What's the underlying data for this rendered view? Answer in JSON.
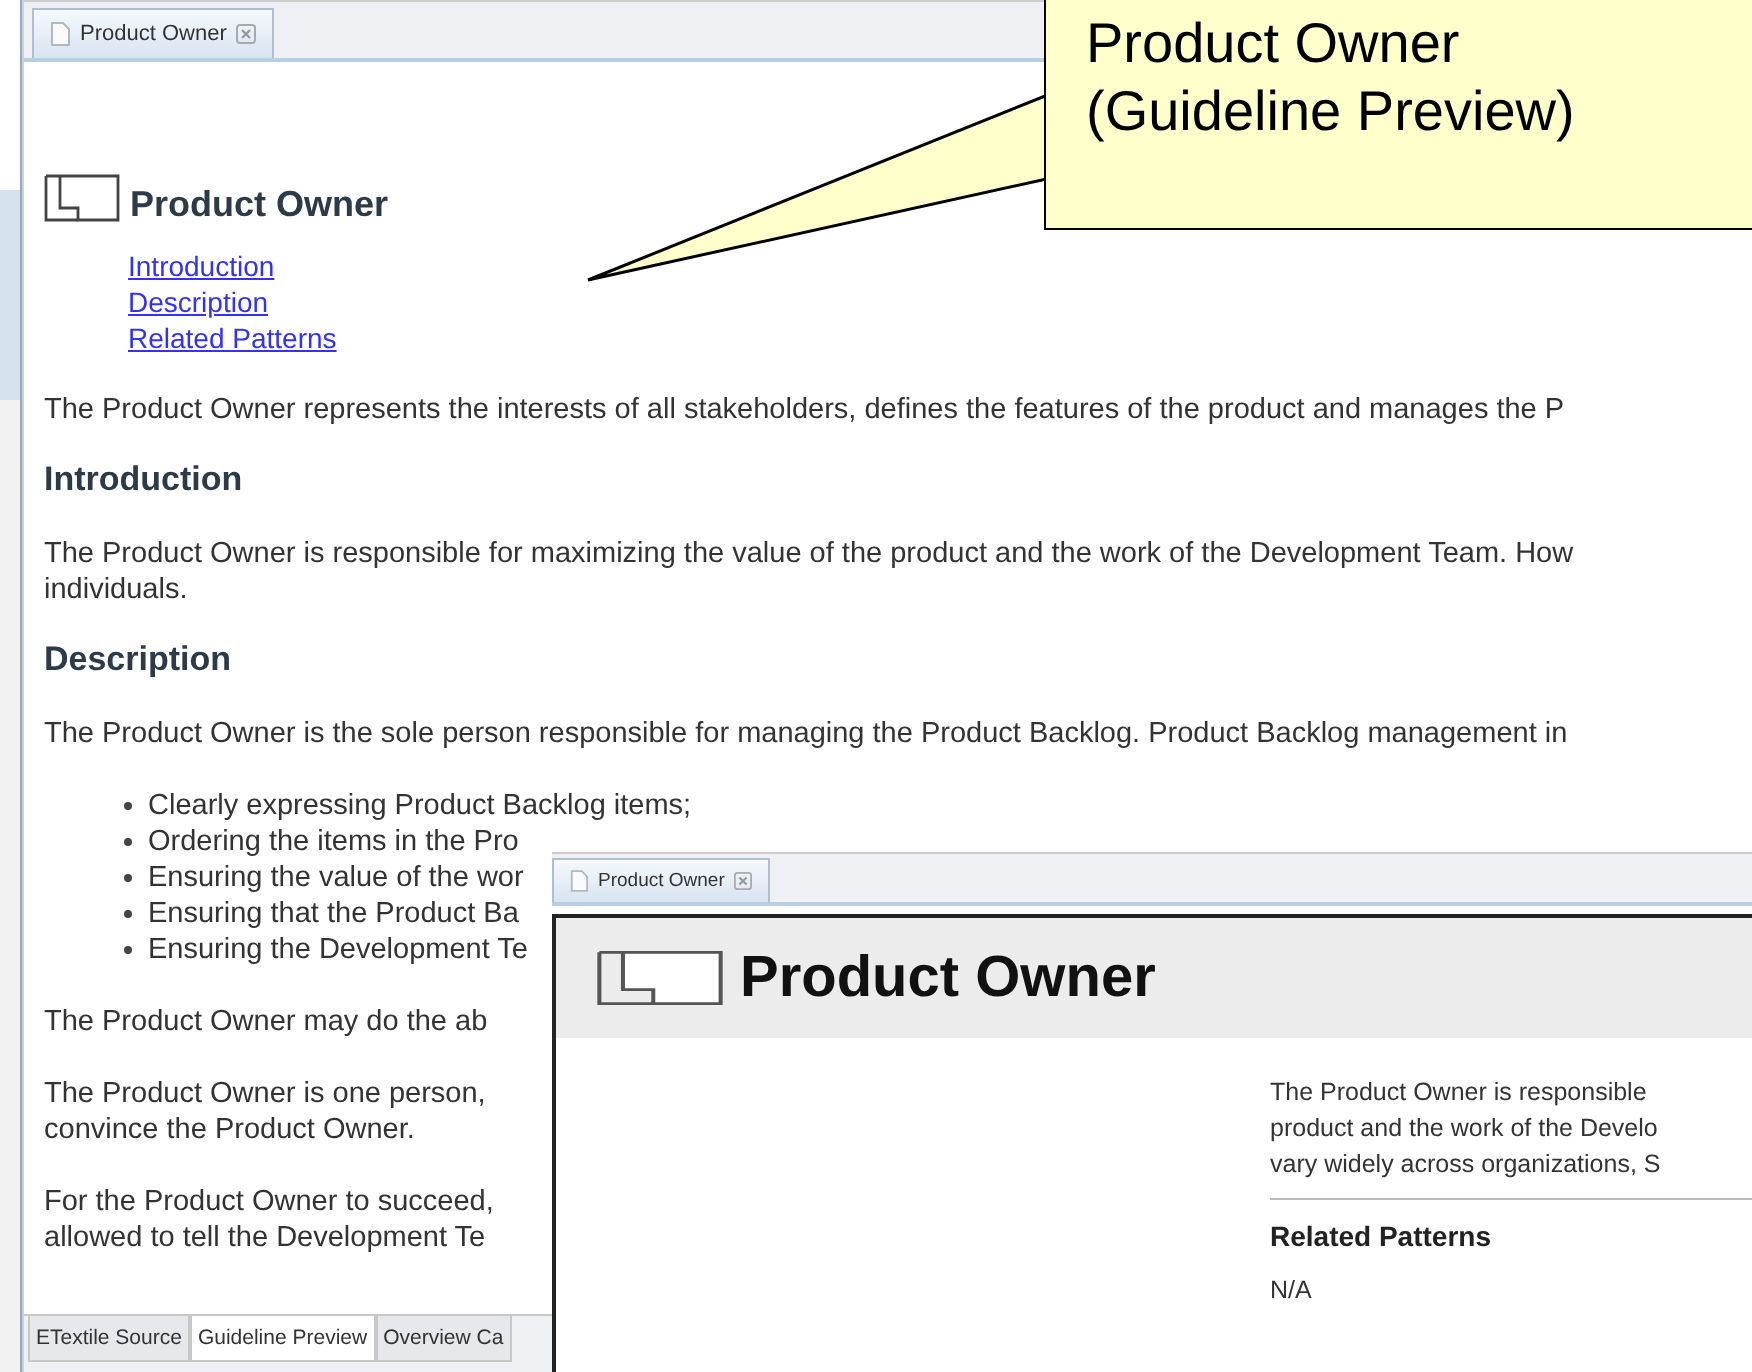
{
  "editor": {
    "tab": {
      "title": "Product Owner",
      "selected": true
    },
    "heading": "Product Owner",
    "links": [
      "Introduction",
      "Description",
      "Related Patterns"
    ],
    "blocks": [
      {
        "kind": "paragraph",
        "lines": [
          "The Product Owner represents the interests of all stakeholders, defines the features of the product and manages the P"
        ]
      },
      {
        "kind": "heading",
        "text": "Introduction"
      },
      {
        "kind": "paragraph",
        "lines": [
          "The Product Owner is responsible for maximizing the value of the product and the work of the Development Team. How",
          "individuals."
        ]
      },
      {
        "kind": "heading",
        "text": "Description"
      },
      {
        "kind": "paragraph",
        "lines": [
          "The Product Owner is the sole person responsible for managing the Product Backlog. Product Backlog management in"
        ]
      },
      {
        "kind": "bullets",
        "items": [
          "Clearly expressing Product Backlog items;",
          "Ordering the items in the Pro",
          "Ensuring the value of the wor",
          "Ensuring that the Product Ba",
          "Ensuring the Development Te"
        ]
      },
      {
        "kind": "paragraph",
        "lines": [
          "The Product Owner may do the ab"
        ]
      },
      {
        "kind": "paragraph",
        "lines": [
          "The Product Owner is one person,",
          "convince the Product Owner."
        ]
      },
      {
        "kind": "paragraph",
        "lines": [
          "For the Product Owner to succeed,",
          "allowed to tell the Development Te"
        ]
      }
    ],
    "bottom_tabs": [
      {
        "label": "ETextile Source",
        "selected": false
      },
      {
        "label": "Guideline Preview",
        "selected": true
      },
      {
        "label": "Overview Ca",
        "selected": false
      }
    ]
  },
  "preview": {
    "tab": {
      "title": "Product Owner",
      "selected": true
    },
    "heading": "Product Owner",
    "description_lines": [
      "The Product Owner is responsible",
      "product and the work of the Develo",
      "vary widely across organizations, S"
    ],
    "related_heading": "Related Patterns",
    "related_value": "N/A"
  },
  "callout": {
    "lines": [
      "Product Owner",
      "(Guideline Preview)"
    ]
  }
}
